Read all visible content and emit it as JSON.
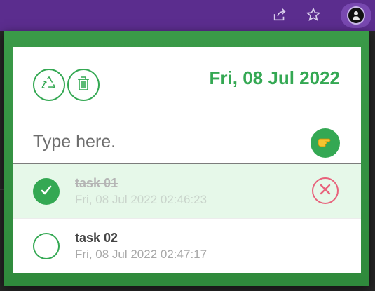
{
  "browser": {
    "share_icon": "share-icon",
    "bookmark_icon": "star-icon",
    "extension_icon": "avatar-icon"
  },
  "popup": {
    "recycle_icon": "recycle-icon",
    "trash_icon": "trash-icon",
    "date": "Fri, 08 Jul 2022",
    "input_placeholder": "Type here.",
    "input_value": "",
    "submit_icon": "pointing-hand-icon",
    "tasks": [
      {
        "name": "task 01",
        "time": "Fri, 08 Jul 2022 02:46:23",
        "done": true
      },
      {
        "name": "task 02",
        "time": "Fri, 08 Jul 2022 02:47:17",
        "done": false
      }
    ]
  },
  "colors": {
    "accent": "#34a853",
    "delete": "#e8637c",
    "done_row_bg": "#e6f8e9",
    "browser_bar": "#5b2d8e"
  }
}
